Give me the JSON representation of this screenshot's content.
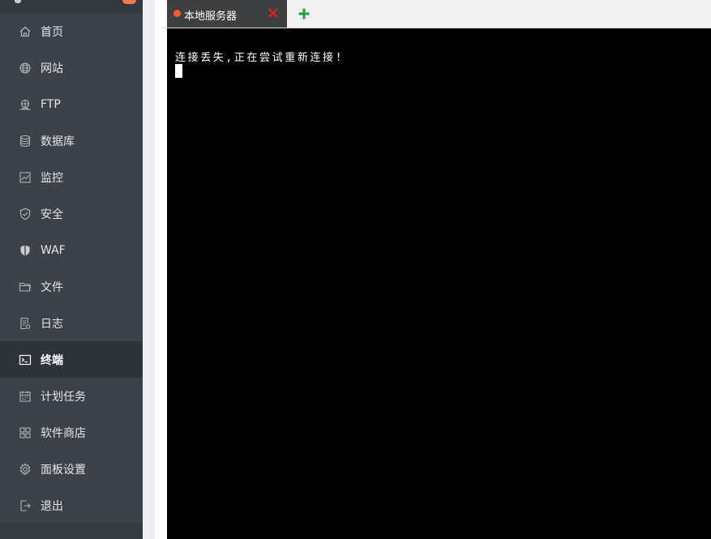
{
  "sidebar": {
    "items": [
      {
        "label": "首页",
        "icon": "home-icon"
      },
      {
        "label": "网站",
        "icon": "globe-icon"
      },
      {
        "label": "FTP",
        "icon": "ftp-icon"
      },
      {
        "label": "数据库",
        "icon": "database-icon"
      },
      {
        "label": "监控",
        "icon": "monitor-icon"
      },
      {
        "label": "安全",
        "icon": "shield-check-icon"
      },
      {
        "label": "WAF",
        "icon": "waf-shield-icon"
      },
      {
        "label": "文件",
        "icon": "folder-icon"
      },
      {
        "label": "日志",
        "icon": "log-icon"
      },
      {
        "label": "终端",
        "icon": "terminal-icon",
        "active": true
      },
      {
        "label": "计划任务",
        "icon": "calendar-icon"
      },
      {
        "label": "软件商店",
        "icon": "apps-grid-icon"
      },
      {
        "label": "面板设置",
        "icon": "gear-icon"
      },
      {
        "label": "退出",
        "icon": "logout-icon"
      }
    ]
  },
  "terminal": {
    "tabs": [
      {
        "label": "本地服务器",
        "status_color": "#f45b2d",
        "close_icon": "close-icon"
      }
    ],
    "add_tab_icon": "plus-icon",
    "output": "连接丢失,正在尝试重新连接!"
  },
  "colors": {
    "sidebar_bg": "#3d4149",
    "sidebar_active_bg": "#2f333a",
    "terminal_bg": "#000000",
    "close_red": "#e02020",
    "add_green": "#20a53a",
    "status_dot": "#f45b2d"
  }
}
